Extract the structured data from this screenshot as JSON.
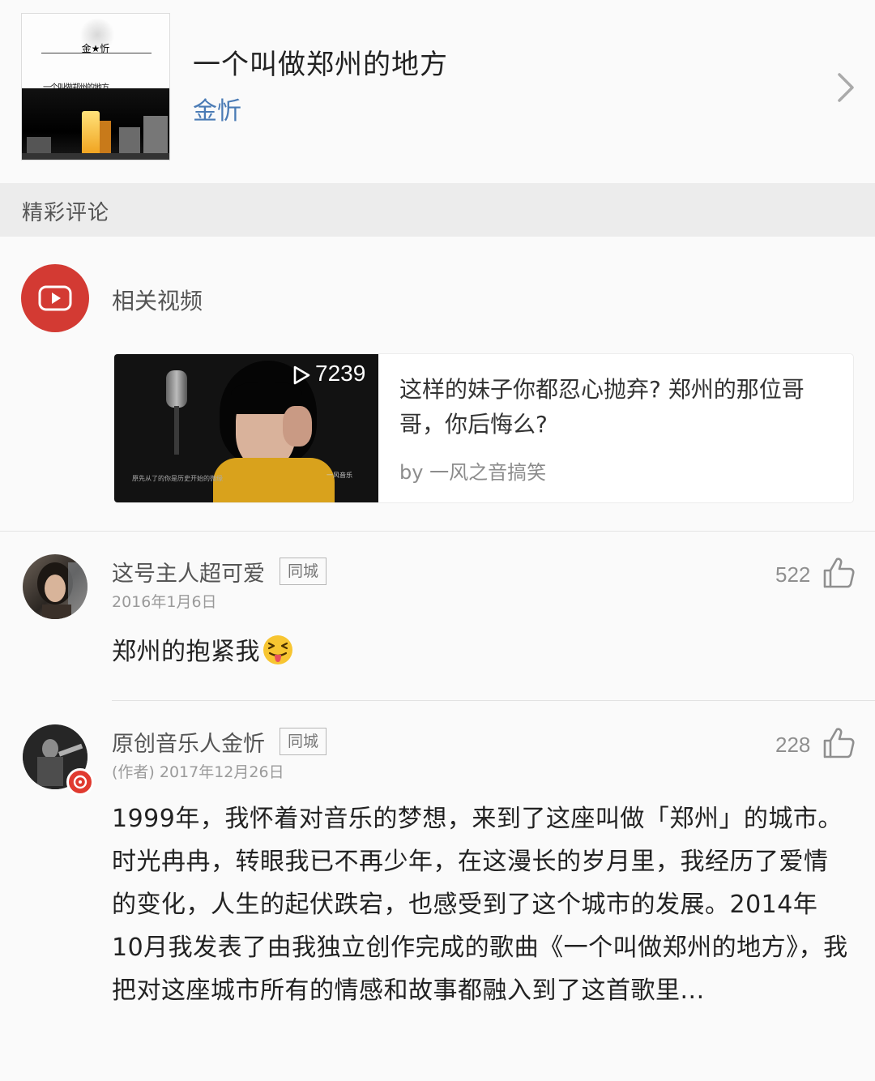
{
  "song": {
    "title": "一个叫做郑州的地方",
    "artist": "金忻",
    "cover": {
      "top_text": "金★忻",
      "handwritten_title": "一个叫做郑州的地方"
    }
  },
  "section": {
    "title": "精彩评论"
  },
  "related_video": {
    "label": "相关视频",
    "play_count": "7239",
    "title": "这样的妹子你都忍心抛弃? 郑州的那位哥哥，你后悔么?",
    "byline": "by 一风之音搞笑",
    "thumbnail_subtitle": "原先从了的你是历史开始的微缘",
    "thumbnail_watermark": "一风音乐"
  },
  "comments": [
    {
      "username": "这号主人超可爱",
      "tag": "同城",
      "date": "2016年1月6日",
      "likes": "522",
      "text": "郑州的抱紧我",
      "emoji": "squinting-tongue-emoji"
    },
    {
      "username": "原创音乐人金忻",
      "tag": "同城",
      "date": "(作者) 2017年12月26日",
      "likes": "228",
      "text": "1999年，我怀着对音乐的梦想，来到了这座叫做「郑州」的城市。时光冉冉，转眼我已不再少年，在这漫长的岁月里，我经历了爱情的变化，人生的起伏跌宕，也感受到了这个城市的发展。2014年10月我发表了由我独立创作完成的歌曲《一个叫做郑州的地方》，我把对这座城市所有的情感和故事都融入到了这首歌里..."
    }
  ],
  "colors": {
    "artist_link": "#4a7bb5",
    "video_badge": "#d33a33",
    "section_bg": "#ececec",
    "page_bg": "#fafafa"
  }
}
